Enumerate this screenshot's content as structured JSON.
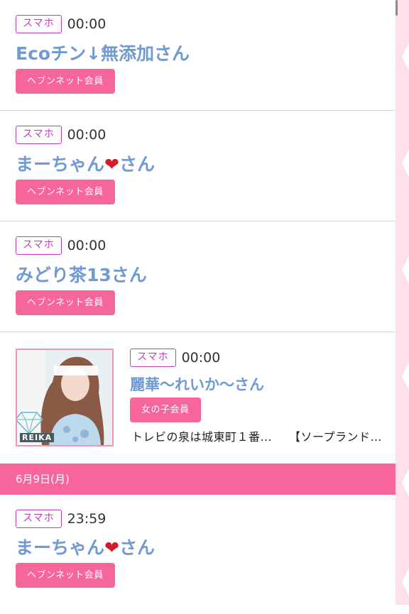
{
  "entries_top": [
    {
      "device": "スマホ",
      "time": "00:00",
      "name": "Ecoチン↓無添加さん",
      "member": "ヘブンネット会員"
    },
    {
      "device": "スマホ",
      "time": "00:00",
      "name_before": "まーちゃん",
      "heart": "❤",
      "name_after": "さん",
      "member": "ヘブンネット会員"
    },
    {
      "device": "スマホ",
      "time": "00:00",
      "name": "みどり茶13さん",
      "member": "ヘブンネット会員"
    }
  ],
  "photo_entry": {
    "device": "スマホ",
    "time": "00:00",
    "name": "麗華〜れいか〜さん",
    "member": "女の子会員",
    "shop_location": "トレビの泉は城東町１番…",
    "shop_category": "【ソープランド…",
    "photo_caption": "REIKA"
  },
  "date_band": "6月9日(月)",
  "entry_bottom": {
    "device": "スマホ",
    "time": "23:59",
    "name_before": "まーちゃん",
    "heart": "❤",
    "name_after": "さん",
    "member": "ヘブンネット会員"
  },
  "colors": {
    "accent_pink": "#f7669b",
    "name_blue": "#6f9ad3",
    "tag_magenta": "#c43bbf"
  }
}
